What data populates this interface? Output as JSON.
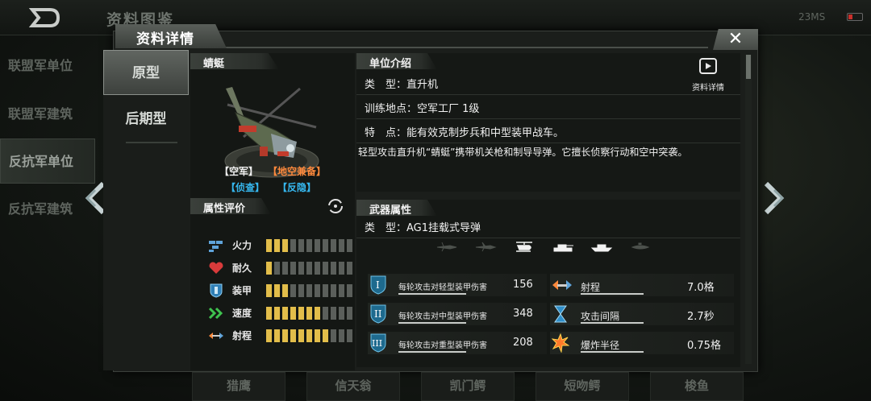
{
  "page_title": "资料图鉴",
  "status": {
    "signal": "23MS"
  },
  "left_nav": [
    "联盟军单位",
    "联盟军建筑",
    "反抗军单位",
    "反抗军建筑"
  ],
  "modal": {
    "title": "资料详情",
    "tabs": [
      "原型",
      "后期型"
    ],
    "unit_name": "蜻蜓",
    "tags": [
      "【空军】",
      "【地空兼备】",
      "【侦查】",
      "【反隐】"
    ],
    "attributes_header": "属性评价",
    "attributes": [
      {
        "label": "火力",
        "icon": "firepower-icon",
        "level": 3,
        "max": 11
      },
      {
        "label": "耐久",
        "icon": "heart-icon",
        "level": 1,
        "max": 11
      },
      {
        "label": "装甲",
        "icon": "armor-shield-icon",
        "level": 3,
        "max": 11
      },
      {
        "label": "速度",
        "icon": "speed-chevron-icon",
        "level": 7,
        "max": 11
      },
      {
        "label": "射程",
        "icon": "range-arrows-icon",
        "level": 8,
        "max": 11
      }
    ],
    "intro_header": "单位介绍",
    "intro_rows": [
      "类　型：直升机",
      "训练地点：空军工厂 1级",
      "特　点：能有效克制步兵和中型装甲战车。"
    ],
    "info_button": "资料详情",
    "description": "轻型攻击直升机“蜻蜓”携带机关枪和制导导弹。它擅长侦察行动和空中突袭。",
    "weapon_header": "武器属性",
    "weapon_type": "类　型：AG1挂载式导弹",
    "target_types": [
      {
        "icon": "fighter-jet-icon",
        "active": false
      },
      {
        "icon": "bomber-jet-icon",
        "active": false
      },
      {
        "icon": "helicopter-icon",
        "active": true
      },
      {
        "icon": "tank-icon",
        "active": true
      },
      {
        "icon": "ship-icon",
        "active": true
      },
      {
        "icon": "submarine-icon",
        "active": false
      }
    ],
    "weapon_stats_left": [
      {
        "label": "每轮攻击对轻型装甲伤害",
        "value": "156",
        "icon": "light-armor-icon"
      },
      {
        "label": "每轮攻击对中型装甲伤害",
        "value": "348",
        "icon": "medium-armor-icon"
      },
      {
        "label": "每轮攻击对重型装甲伤害",
        "value": "208",
        "icon": "heavy-armor-icon"
      }
    ],
    "weapon_stats_right": [
      {
        "label": "射程",
        "value": "7.0格",
        "icon": "range-icon"
      },
      {
        "label": "攻击间隔",
        "value": "2.7秒",
        "icon": "hourglass-icon"
      },
      {
        "label": "爆炸半径",
        "value": "0.75格",
        "icon": "explosion-icon"
      }
    ]
  },
  "bottom_tabs": [
    "猎鹰",
    "信天翁",
    "凯门鳄",
    "短吻鳄",
    "梭鱼"
  ],
  "colors": {
    "bar_on": "#e2bd4a",
    "bar_off": "#5b5f5b",
    "tag_orange": "#ff8a3d",
    "tag_blue": "#36b8f0"
  }
}
